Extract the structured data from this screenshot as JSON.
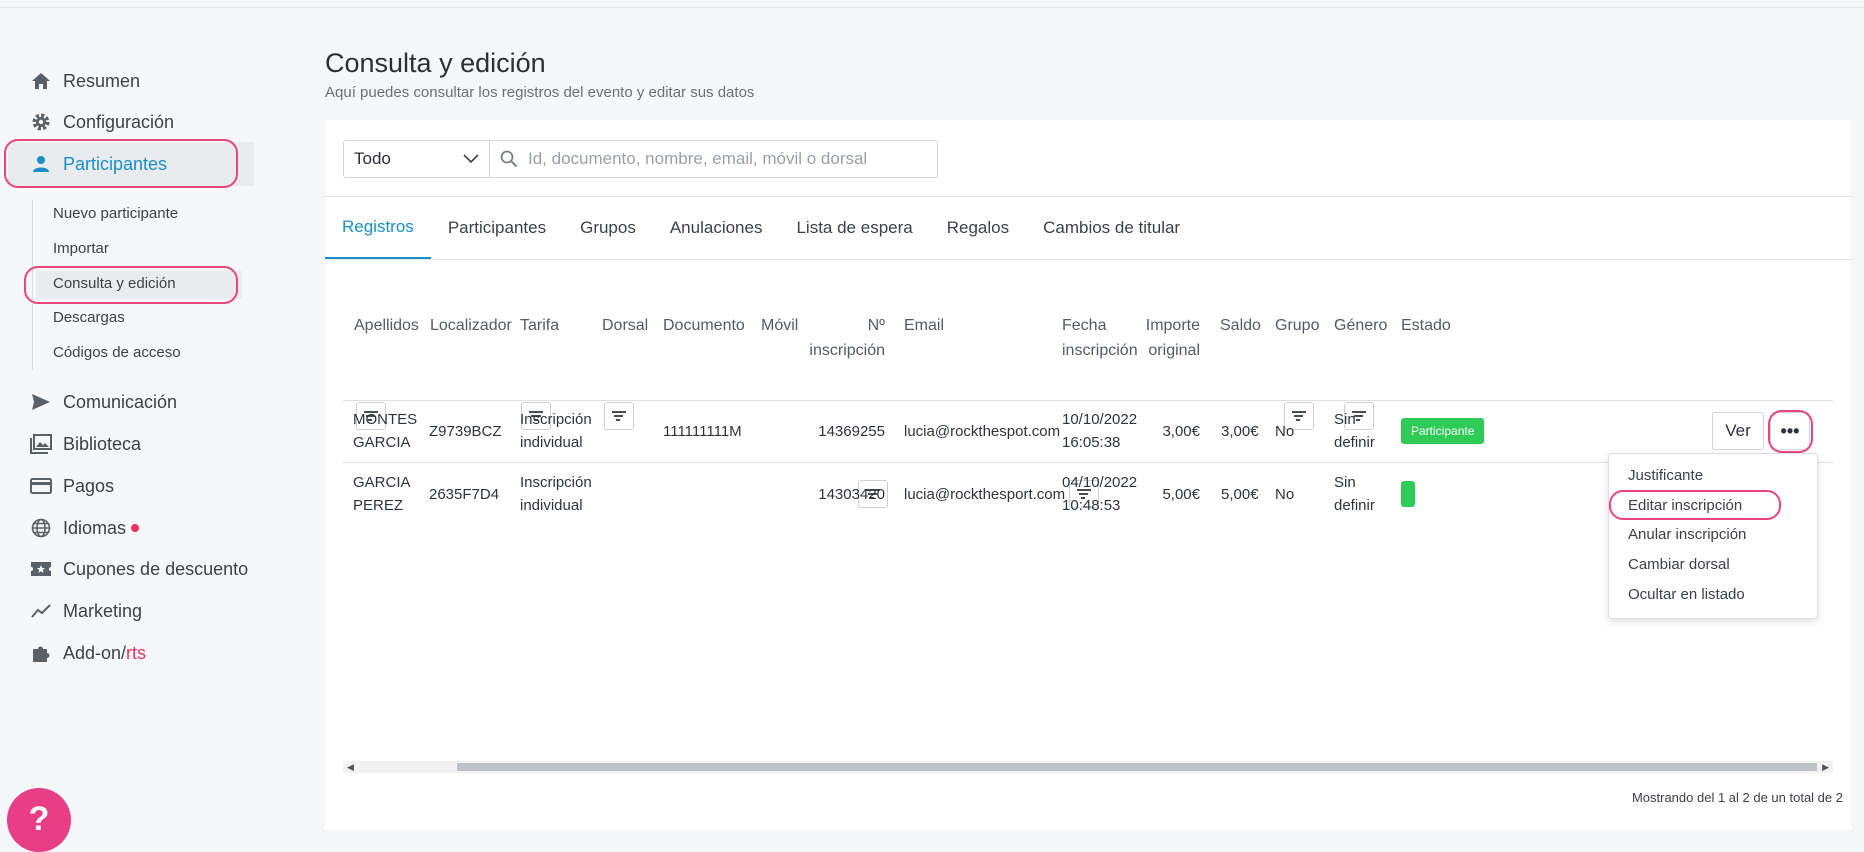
{
  "sidebar": {
    "items": [
      {
        "label": "Resumen",
        "icon": "home-icon"
      },
      {
        "label": "Configuración",
        "icon": "gear-icon"
      },
      {
        "label": "Participantes",
        "icon": "user-icon"
      },
      {
        "label": "Comunicación",
        "icon": "send-icon"
      },
      {
        "label": "Biblioteca",
        "icon": "image-library-icon"
      },
      {
        "label": "Pagos",
        "icon": "credit-card-icon"
      },
      {
        "label": "Idiomas",
        "icon": "globe-icon"
      },
      {
        "label": "Cupones de descuento",
        "icon": "coupon-icon"
      },
      {
        "label": "Marketing",
        "icon": "trend-icon"
      },
      {
        "label": "Add-on/",
        "label_suffix": "rts",
        "icon": "puzzle-icon"
      }
    ],
    "subitems": [
      "Nuevo participante",
      "Importar",
      "Consulta y edición",
      "Descargas",
      "Códigos de acceso"
    ],
    "help_label": "?"
  },
  "header": {
    "title": "Consulta y edición",
    "subtitle": "Aquí puedes consultar los registros del evento y editar sus datos"
  },
  "filter": {
    "select_value": "Todo",
    "search_placeholder": "Id, documento, nombre, email, móvil o dorsal"
  },
  "tabs": [
    "Registros",
    "Participantes",
    "Grupos",
    "Anulaciones",
    "Lista de espera",
    "Regalos",
    "Cambios de titular"
  ],
  "table": {
    "columns": {
      "apellidos": "Apellidos",
      "localizador": "Localizador",
      "tarifa": "Tarifa",
      "dorsal": "Dorsal",
      "documento": "Documento",
      "movil": "Móvil",
      "n_inscripcion_1": "Nº",
      "n_inscripcion_2": "inscripción",
      "email": "Email",
      "fecha_1": "Fecha",
      "fecha_2": "inscripción",
      "importe_1": "Importe",
      "importe_2": "original",
      "saldo": "Saldo",
      "grupo": "Grupo",
      "genero": "Género",
      "estado": "Estado"
    },
    "rows": [
      {
        "apellidos_1": "MONTES",
        "apellidos_2": "GARCIA",
        "localizador": "Z9739BCZ",
        "tarifa_1": "Inscripción",
        "tarifa_2": "individual",
        "dorsal": "",
        "documento": "111111111M",
        "movil": "",
        "n_inscripcion": "14369255",
        "email": "lucia@rockthespot.com",
        "fecha_1": "10/10/2022",
        "fecha_2": "16:05:38",
        "importe": "3,00€",
        "saldo": "3,00€",
        "grupo": "No",
        "genero_1": "Sin",
        "genero_2": "definir",
        "estado": "Participante"
      },
      {
        "apellidos_1": "GARCIA",
        "apellidos_2": "PEREZ",
        "localizador": "2635F7D4",
        "tarifa_1": "Inscripción",
        "tarifa_2": "individual",
        "dorsal": "",
        "documento": "",
        "movil": "",
        "n_inscripcion": "14303420",
        "email": "lucia@rockthesport.com",
        "fecha_1": "04/10/2022",
        "fecha_2": "10:48:53",
        "importe": "5,00€",
        "saldo": "5,00€",
        "grupo": "No",
        "genero_1": "Sin",
        "genero_2": "definir",
        "estado": ""
      }
    ],
    "ver_label": "Ver",
    "more_label": "•••"
  },
  "dropdown": {
    "items": [
      "Justificante",
      "Editar inscripción",
      "Anular inscripción",
      "Cambiar dorsal",
      "Ocultar en listado"
    ]
  },
  "footer": {
    "info": "Mostrando del 1 al 2 de un total de 2"
  },
  "colors": {
    "accent": "#1a8fc7",
    "highlight": "#e8457a",
    "badge": "#2ecb57",
    "help": "#e83e86"
  }
}
